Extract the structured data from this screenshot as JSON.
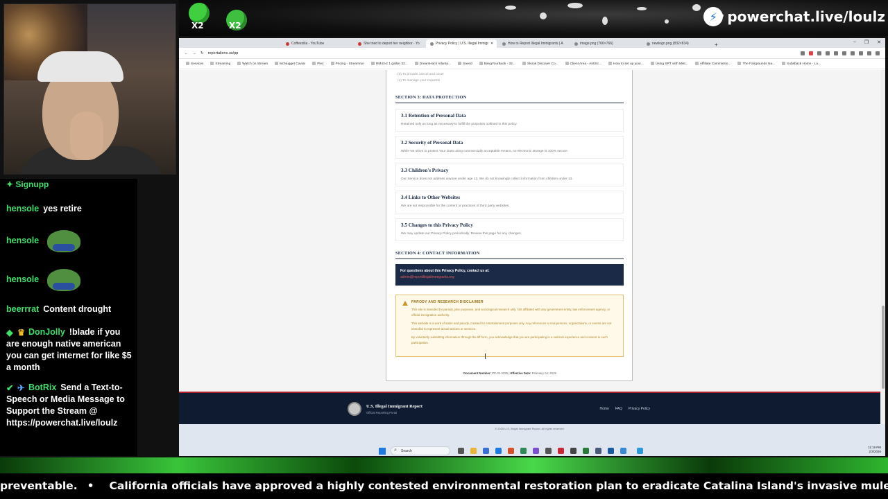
{
  "overlay": {
    "brand": "powerchat.live/loulz",
    "emote_count_1": "X2",
    "emote_count_2": "X2"
  },
  "chat": {
    "first_line": "Signupp",
    "messages": [
      {
        "user": "hensole",
        "text": "yes retire"
      },
      {
        "user": "hensole",
        "text": ""
      },
      {
        "user": "hensole",
        "text": ""
      },
      {
        "user": "beerrrat",
        "text": "Content drought"
      },
      {
        "user": "DonJolly",
        "text": "!blade if you are enough native american you can get internet for like $5 a month"
      },
      {
        "user": "BotRix",
        "text": "Send a Text-to-Speech or Media Message to Support the Stream @ https://powerchat.live/loulz"
      }
    ]
  },
  "browser": {
    "tabs": [
      {
        "label": "Coffeezilla - YouTube"
      },
      {
        "label": "She tried to deport her neighbor - Yo"
      },
      {
        "label": "Privacy Policy | U.S. Illegal Immigr"
      },
      {
        "label": "How to Report Illegal Immigrants | A"
      },
      {
        "label": "image.png (766×766)"
      },
      {
        "label": "newlogo.png (832×834)"
      }
    ],
    "new_tab": "+",
    "url": "reportaliens.us/pp",
    "bookmarks": [
      "Services",
      "Streaming",
      "Watch on Stream",
      "McNugget Caviar",
      "Plex",
      "Pricing - Streamrun",
      "RM43-2 1 gallon 32...",
      "DreamHack Atlanta...",
      "Saved",
      "BangYourBuck - 32...",
      "Skook Discover Co...",
      "Client Area - AntiSc...",
      "How to set up your...",
      "Using SRT with Mist...",
      "Affiliate Commissio...",
      "The Fairgrounds Na...",
      "Subsback Home - Lo..."
    ],
    "window_controls": [
      "–",
      "❐",
      "✕"
    ]
  },
  "document": {
    "prev_items": [
      "(d) To provide cancel and cover",
      "(e) To manage your requests"
    ],
    "section3_title": "SECTION 3: DATA PROTECTION",
    "subsections": [
      {
        "title": "3.1 Retention of Personal Data",
        "body": "Retained only as long as necessary to fulfill the purposes outlined in this policy."
      },
      {
        "title": "3.2 Security of Personal Data",
        "body": "While we strive to protect Your Data using commercially acceptable means, no electronic storage is 100% secure."
      },
      {
        "title": "3.3 Children's Privacy",
        "body": "Our Service does not address anyone under age 13. We do not knowingly collect information from children under 13."
      },
      {
        "title": "3.4 Links to Other Websites",
        "body": "We are not responsible for the content or practices of third party websites."
      },
      {
        "title": "3.5 Changes to this Privacy Policy",
        "body": "We may update our Privacy Policy periodically. Review this page for any changes."
      }
    ],
    "section4_title": "SECTION 4: CONTACT INFORMATION",
    "contact_label": "For questions about this Privacy Policy, contact us at:",
    "contact_email": "admin@reportillegalimmigrants.org",
    "disclaimer": {
      "title": "PARODY AND RESEARCH DISCLAIMER",
      "p1": "This site is intended for parody, joke purposes, and sociological research only. Not affiliated with any government entity, law enforcement agency, or official immigration authority.",
      "p2": "This website is a work of satire and parody, created for entertainment purposes only. Any references to real persons, organizations, or events are not intended to represent actual actions or services.",
      "p3": "By voluntarily submitting information through the tiff form, you acknowledge that you are participating in a satirical experience and consent to such participation."
    },
    "doc_number_label": "Document Number:",
    "doc_number": "PP-01-2025",
    "effective_label": "Effective Date:",
    "effective_date": "February 04, 2025"
  },
  "site_footer": {
    "brand": "U.S. Illegal Immigrant Report",
    "tagline": "Official Reporting Portal",
    "links": [
      "Home",
      "FAQ",
      "Privacy Policy"
    ],
    "copyright": "© 2025 U.S. Illegal Immigrant Report. All rights reserved."
  },
  "taskbar": {
    "search_placeholder": "Search",
    "time": "11:19 PM",
    "date": "2/3/2026"
  },
  "ticker": {
    "text_left": "preventable.",
    "text_main": "California officials have approved a highly contested environmental restoration plan to eradicate Catalina Island's invasive mule deer"
  },
  "colors": {
    "navy": "#1b2a46",
    "footer_navy": "#0f1b30",
    "accent_red": "#b11e2e",
    "warning_gold": "#c9962a",
    "chat_user_green": "#3fe06a"
  }
}
